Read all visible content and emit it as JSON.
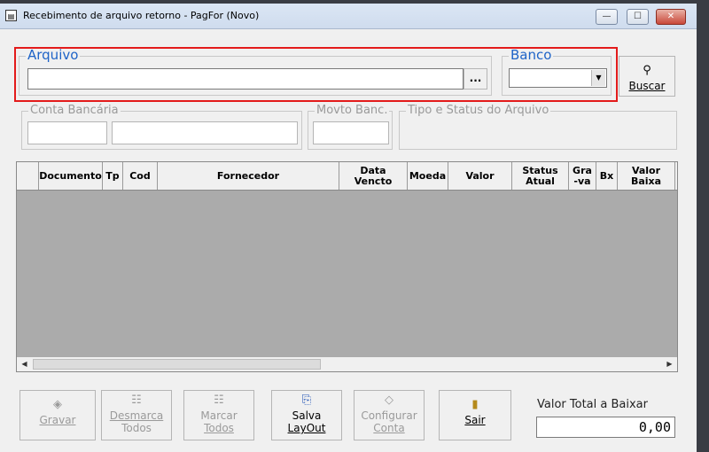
{
  "window": {
    "title": "Recebimento de arquivo retorno - PagFor (Novo)",
    "minimize_glyph": "—",
    "maximize_glyph": "☐",
    "close_glyph": "✕"
  },
  "arquivo": {
    "label": "Arquivo",
    "value": "",
    "browse_label": "..."
  },
  "banco": {
    "label": "Banco",
    "value": ""
  },
  "buscar": {
    "label": "Buscar",
    "icon": "binoculars-icon"
  },
  "conta_bancaria": {
    "label": "Conta Bancária",
    "agencia": "",
    "conta": ""
  },
  "movto_banc": {
    "label": "Movto Banc.",
    "value": ""
  },
  "tipo_status": {
    "label": "Tipo e Status do Arquivo"
  },
  "grid": {
    "columns": [
      "Documento",
      "Tp",
      "Cod",
      "Fornecedor",
      "Data Vencto",
      "Moeda",
      "Valor",
      "Status Atual",
      "Gra-va",
      "Bx",
      "Valor Baixa"
    ],
    "rows": []
  },
  "buttons": {
    "gravar": "Gravar",
    "desmarca_l1": "Desmarca",
    "desmarca_l2": "Todos",
    "marcar_l1": "Marcar",
    "marcar_l2": "Todos",
    "salva_l1": "Salva",
    "salva_l2": "LayOut",
    "configurar_l1": "Configurar",
    "configurar_l2": "Conta",
    "sair": "Sair"
  },
  "valor_total": {
    "label": "Valor Total a Baixar",
    "value": "0,00"
  }
}
